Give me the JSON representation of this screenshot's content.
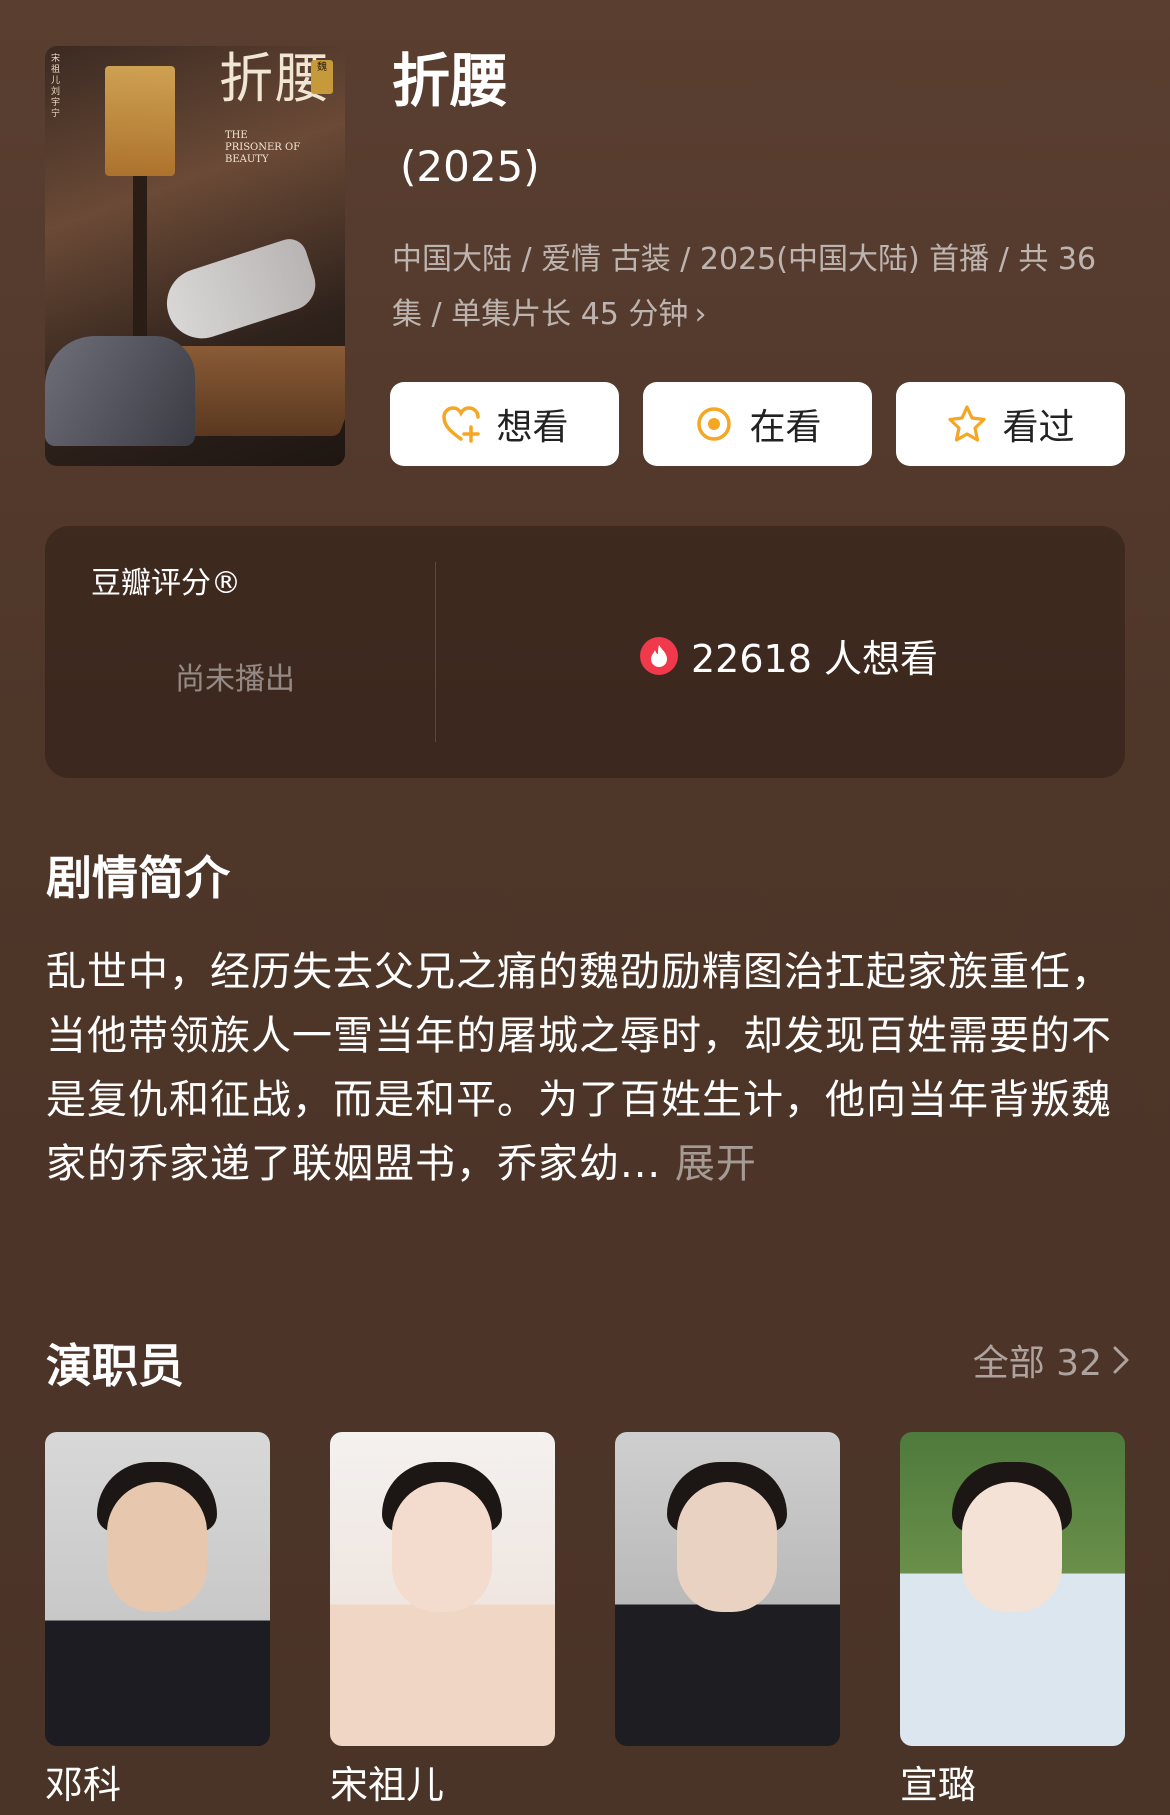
{
  "poster": {
    "title_art": "折腰",
    "title_en": "THE PRISONER OF BEAUTY",
    "seal": "魏",
    "credits": "宋祖儿 刘宇宁"
  },
  "header": {
    "title": "折腰",
    "year": "(2025)",
    "meta_line": "中国大陆 / 爱情 古装 / 2025(中国大陆) 首播 / 共 36 集 / 单集片长 45 分钟",
    "meta_chevron": "›"
  },
  "actions": [
    {
      "label": "想看",
      "icon": "heart-plus-icon"
    },
    {
      "label": "在看",
      "icon": "target-icon"
    },
    {
      "label": "看过",
      "icon": "star-icon"
    }
  ],
  "rating": {
    "label": "豆瓣评分®",
    "status": "尚未播出",
    "wish_text": "22618 人想看",
    "wish_icon": "flame-icon"
  },
  "synopsis": {
    "heading": "剧情简介",
    "text": "乱世中，经历失去父兄之痛的魏劭励精图治扛起家族重任，当他带领族人一雪当年的屠城之辱时，却发现百姓需要的不是复仇和征战，而是和平。为了百姓生计，他向当年背叛魏家的乔家递了联姻盟书，乔家幼...",
    "expand": "展开"
  },
  "cast": {
    "heading": "演职员",
    "all_link": "全部 32",
    "members": [
      {
        "name": "邓科"
      },
      {
        "name": "宋祖儿"
      },
      {
        "name": ""
      },
      {
        "name": "宣璐"
      }
    ]
  },
  "colors": {
    "background": "#553b2e",
    "accent_orange": "#f5a623",
    "flame_red": "#f0394a"
  }
}
